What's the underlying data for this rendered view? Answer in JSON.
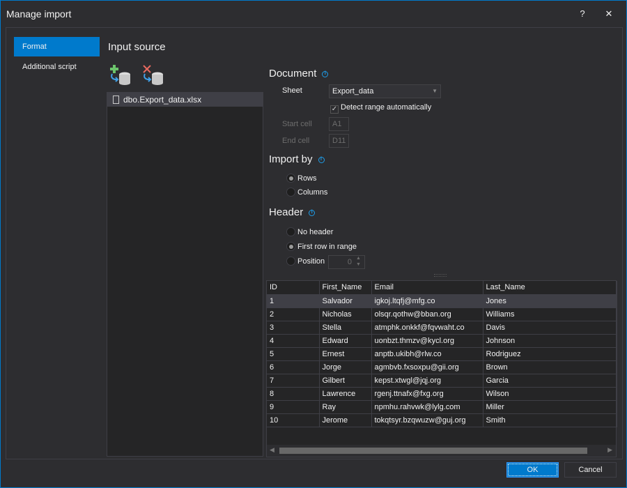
{
  "window": {
    "title": "Manage import",
    "help": "?",
    "close": "✕"
  },
  "nav": {
    "items": [
      {
        "label": "Format",
        "active": true
      },
      {
        "label": "Additional script",
        "active": false
      }
    ]
  },
  "input_source": {
    "title": "Input source",
    "add_icon": "add-datasource-icon",
    "remove_icon": "remove-datasource-icon",
    "files": [
      "dbo.Export_data.xlsx"
    ]
  },
  "document": {
    "title": "Document",
    "sheet_label": "Sheet",
    "sheet_value": "Export_data",
    "detect_label": "Detect range automatically",
    "detect_checked": true,
    "start_label": "Start cell",
    "start_value": "A1",
    "end_label": "End cell",
    "end_value": "D11"
  },
  "import_by": {
    "title": "Import by",
    "options": [
      "Rows",
      "Columns"
    ],
    "selected": "Rows"
  },
  "header": {
    "title": "Header",
    "options": [
      "No header",
      "First row in range",
      "Position"
    ],
    "selected": "First row in range",
    "position_value": "0"
  },
  "grid": {
    "columns": [
      "ID",
      "First_Name",
      "Email",
      "Last_Name"
    ],
    "rows": [
      [
        "1",
        "Salvador",
        "igkoj.ltqfj@mfg.co",
        "Jones"
      ],
      [
        "2",
        "Nicholas",
        "olsqr.qothw@bban.org",
        "Williams"
      ],
      [
        "3",
        "Stella",
        "atmphk.onkkf@fqvwaht.co",
        "Davis"
      ],
      [
        "4",
        "Edward",
        "uonbzt.thmzv@kycl.org",
        "Johnson"
      ],
      [
        "5",
        "Ernest",
        "anptb.ukibh@rlw.co",
        "Rodriguez"
      ],
      [
        "6",
        "Jorge",
        "agmbvb.fxsoxpu@gii.org",
        "Brown"
      ],
      [
        "7",
        "Gilbert",
        "kepst.xtwgl@jqj.org",
        "Garcia"
      ],
      [
        "8",
        "Lawrence",
        "rgenj.ttnafx@fxg.org",
        "Wilson"
      ],
      [
        "9",
        "Ray",
        "npmhu.rahvwk@lylg.com",
        "Miller"
      ],
      [
        "10",
        "Jerome",
        "tokqtsyr.bzqwuzw@guj.org",
        "Smith"
      ]
    ]
  },
  "buttons": {
    "ok": "OK",
    "cancel": "Cancel"
  },
  "colors": {
    "accent": "#007acc",
    "background": "#2d2d30"
  }
}
